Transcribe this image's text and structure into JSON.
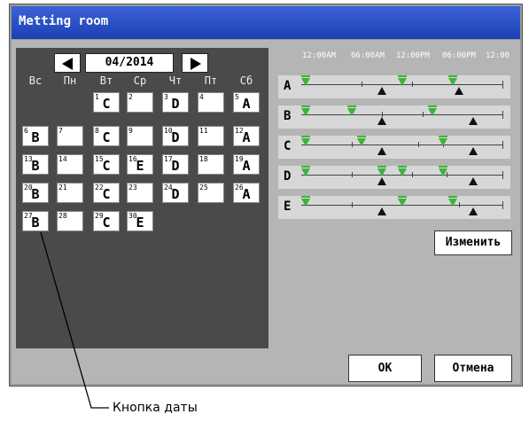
{
  "window": {
    "title": "Metting room"
  },
  "calendar": {
    "month_label": "04/2014",
    "weekdays": [
      "Вс",
      "Пн",
      "Вт",
      "Ср",
      "Чт",
      "Пт",
      "Сб"
    ],
    "days": [
      {
        "num": "1",
        "letter": "C"
      },
      {
        "num": "2",
        "letter": ""
      },
      {
        "num": "3",
        "letter": "D"
      },
      {
        "num": "4",
        "letter": ""
      },
      {
        "num": "5",
        "letter": "A"
      },
      {
        "num": "6",
        "letter": "B"
      },
      {
        "num": "7",
        "letter": ""
      },
      {
        "num": "8",
        "letter": "C"
      },
      {
        "num": "9",
        "letter": ""
      },
      {
        "num": "10",
        "letter": "D"
      },
      {
        "num": "11",
        "letter": ""
      },
      {
        "num": "12",
        "letter": "A"
      },
      {
        "num": "13",
        "letter": "B"
      },
      {
        "num": "14",
        "letter": ""
      },
      {
        "num": "15",
        "letter": "C"
      },
      {
        "num": "16",
        "letter": "E"
      },
      {
        "num": "17",
        "letter": "D"
      },
      {
        "num": "18",
        "letter": ""
      },
      {
        "num": "19",
        "letter": "A"
      },
      {
        "num": "20",
        "letter": "B"
      },
      {
        "num": "21",
        "letter": ""
      },
      {
        "num": "22",
        "letter": "C"
      },
      {
        "num": "23",
        "letter": ""
      },
      {
        "num": "24",
        "letter": "D"
      },
      {
        "num": "25",
        "letter": ""
      },
      {
        "num": "26",
        "letter": "A"
      },
      {
        "num": "27",
        "letter": "B"
      },
      {
        "num": "28",
        "letter": ""
      },
      {
        "num": "29",
        "letter": "C"
      },
      {
        "num": "30",
        "letter": "E"
      }
    ]
  },
  "schedule": {
    "time_labels": [
      "12:00AM",
      "06:00AM",
      "12:00PM",
      "06:00PM",
      "12:00"
    ],
    "patterns": [
      {
        "label": "A",
        "ticks": [
          0.3,
          0.55
        ],
        "green": [
          0.02,
          0.5,
          0.75
        ],
        "black": [
          0.4,
          0.78
        ]
      },
      {
        "label": "B",
        "ticks": [
          0.4,
          0.6
        ],
        "green": [
          0.02,
          0.25,
          0.65
        ],
        "black": [
          0.4,
          0.85
        ]
      },
      {
        "label": "C",
        "ticks": [
          0.25,
          0.58,
          0.7
        ],
        "green": [
          0.02,
          0.3,
          0.7
        ],
        "black": [
          0.4,
          0.85
        ]
      },
      {
        "label": "D",
        "ticks": [
          0.25,
          0.55,
          0.72
        ],
        "green": [
          0.02,
          0.4,
          0.5,
          0.7
        ],
        "black": [
          0.4,
          0.85
        ]
      },
      {
        "label": "E",
        "ticks": [
          0.25,
          0.78
        ],
        "green": [
          0.02,
          0.5,
          0.75
        ],
        "black": [
          0.4,
          0.85
        ]
      }
    ]
  },
  "buttons": {
    "change": "Изменить",
    "ok": "OK",
    "cancel": "Отмена"
  },
  "callout": {
    "text": "Кнопка даты"
  },
  "colors": {
    "title_bar": "#2a52c8",
    "green_marker": "#3cb43c",
    "black_marker": "#111111"
  }
}
